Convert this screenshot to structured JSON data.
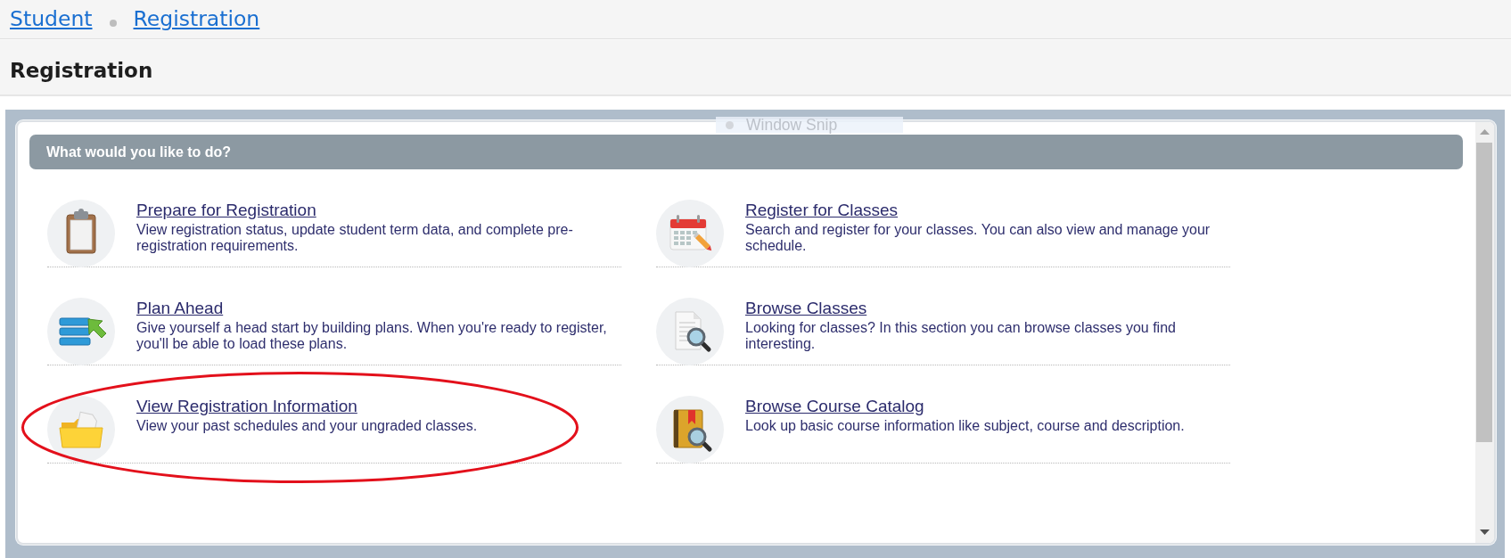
{
  "breadcrumbs": [
    {
      "label": "Student"
    },
    {
      "label": "Registration"
    }
  ],
  "page_title": "Registration",
  "snip_tooltip": {
    "label": "Window Snip"
  },
  "panel": {
    "heading": "What would you like to do?",
    "items": [
      {
        "title": "Prepare for Registration",
        "description": "View registration status, update student term data, and complete pre-registration requirements.",
        "circled": false
      },
      {
        "title": "Register for Classes",
        "description": "Search and register for your classes. You can also view and manage your schedule.",
        "circled": false
      },
      {
        "title": "Plan Ahead",
        "description": "Give yourself a head start by building plans. When you're ready to register, you'll be able to load these plans.",
        "circled": false
      },
      {
        "title": "Browse Classes",
        "description": "Looking for classes? In this section you can browse classes you find interesting.",
        "circled": false
      },
      {
        "title": "View Registration Information",
        "description": "View your past schedules and your ungraded classes.",
        "circled": true
      },
      {
        "title": "Browse Course Catalog",
        "description": "Look up basic course information like subject, course and description.",
        "circled": false
      }
    ]
  }
}
